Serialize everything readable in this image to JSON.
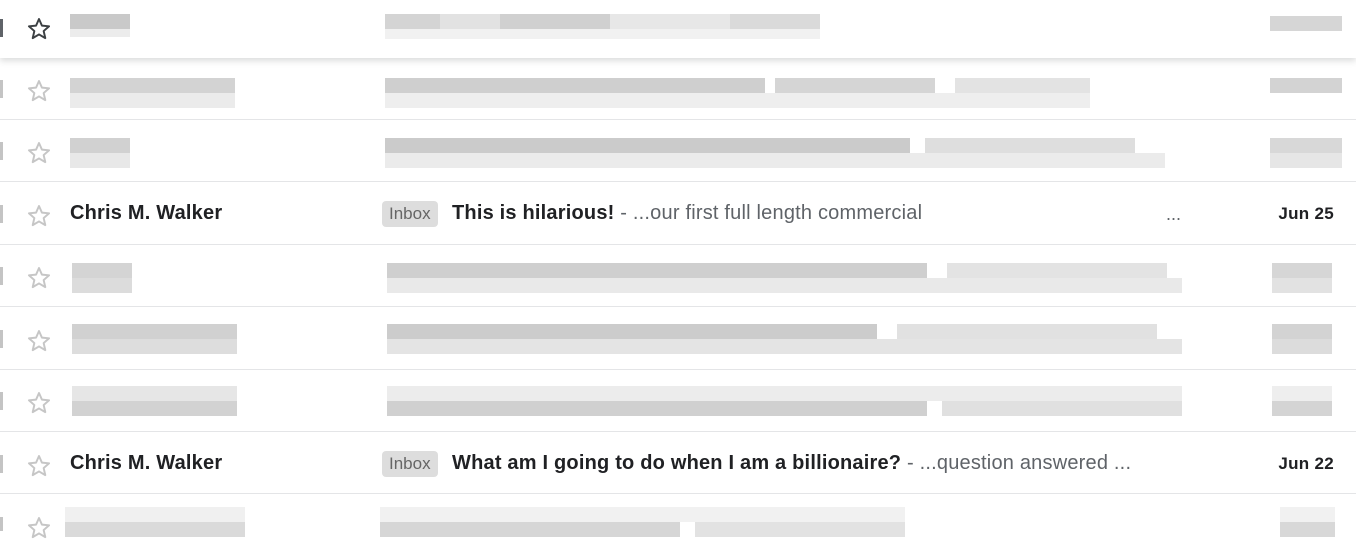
{
  "inbox": {
    "redacted_rows": 7,
    "emails": [
      {
        "sender": "Chris M. Walker",
        "label": "Inbox",
        "subject": "This is hilarious!",
        "separator": " - ",
        "snippet": "...our first full length commercial",
        "ellipsis": "...",
        "date": "Jun 25",
        "starred": false,
        "unread": true
      },
      {
        "sender": "Chris M. Walker",
        "label": "Inbox",
        "subject": "What am I going to do when I am a billionaire?",
        "separator": " - ",
        "snippet": "...question answered ...",
        "ellipsis": "",
        "date": "Jun 22",
        "starred": false,
        "unread": true
      }
    ]
  },
  "icons": {
    "star": "star-outline-icon"
  },
  "colors": {
    "label_chip_bg": "#dddddd",
    "label_chip_text": "#666666",
    "divider": "#e4e5e7",
    "star_stroke": "#c6c6c6",
    "star_stroke_active": "#3c4043"
  }
}
